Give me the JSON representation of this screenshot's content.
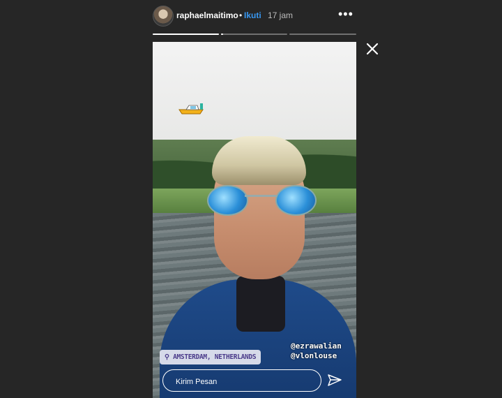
{
  "header": {
    "username": "raphaelmaitimo",
    "separator": "•",
    "follow_label": "Ikuti",
    "time": "17 jam",
    "more_icon": "more-horizontal-icon"
  },
  "progress": {
    "segments": [
      1.0,
      0.03,
      0.0
    ]
  },
  "story": {
    "location": "AMSTERDAM, NETHERLANDS",
    "mentions": [
      "@ezrawalian",
      "@vlonlouse"
    ],
    "sticker_icon": "speedboat-icon"
  },
  "reply": {
    "placeholder": "Kirim Pesan"
  },
  "colors": {
    "background": "#262626",
    "follow": "#3897f0",
    "jacket": "#1f4b8a",
    "lens": "#2a8fd8"
  }
}
